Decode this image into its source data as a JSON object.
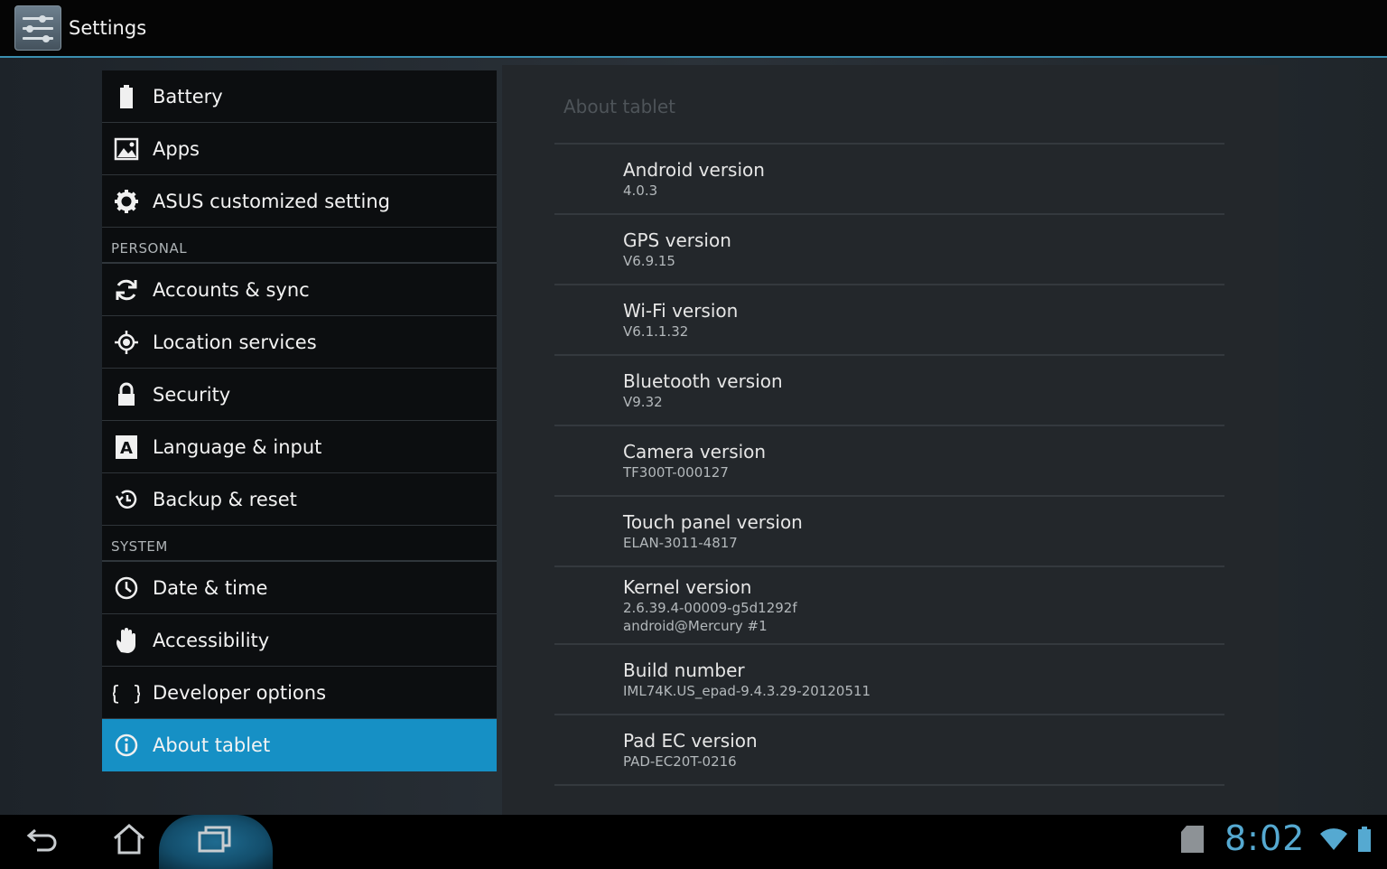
{
  "actionbar": {
    "title": "Settings",
    "icon": "settings-app-icon"
  },
  "sidebar": {
    "items": [
      {
        "type": "item",
        "label": "Battery",
        "icon": "battery-icon"
      },
      {
        "type": "item",
        "label": "Apps",
        "icon": "apps-icon"
      },
      {
        "type": "item",
        "label": "ASUS customized setting",
        "icon": "gear-icon"
      },
      {
        "type": "section",
        "label": "PERSONAL"
      },
      {
        "type": "item",
        "label": "Accounts & sync",
        "icon": "sync-icon"
      },
      {
        "type": "item",
        "label": "Location services",
        "icon": "location-icon"
      },
      {
        "type": "item",
        "label": "Security",
        "icon": "lock-icon"
      },
      {
        "type": "item",
        "label": "Language & input",
        "icon": "language-icon"
      },
      {
        "type": "item",
        "label": "Backup & reset",
        "icon": "backup-icon"
      },
      {
        "type": "section",
        "label": "SYSTEM"
      },
      {
        "type": "item",
        "label": "Date & time",
        "icon": "clock-icon"
      },
      {
        "type": "item",
        "label": "Accessibility",
        "icon": "hand-icon"
      },
      {
        "type": "item",
        "label": "Developer options",
        "icon": "braces-icon"
      },
      {
        "type": "item",
        "label": "About tablet",
        "icon": "info-icon",
        "selected": true
      }
    ]
  },
  "about": {
    "title": "About tablet",
    "entries": [
      {
        "title": "Android version",
        "values": [
          "4.0.3"
        ]
      },
      {
        "title": "GPS version",
        "values": [
          "V6.9.15"
        ]
      },
      {
        "title": "Wi-Fi version",
        "values": [
          "V6.1.1.32"
        ]
      },
      {
        "title": "Bluetooth version",
        "values": [
          "V9.32"
        ]
      },
      {
        "title": "Camera version",
        "values": [
          "TF300T-000127"
        ]
      },
      {
        "title": "Touch panel version",
        "values": [
          "ELAN-3011-4817"
        ]
      },
      {
        "title": "Kernel version",
        "values": [
          "2.6.39.4-00009-g5d1292f",
          "android@Mercury #1"
        ]
      },
      {
        "title": "Build number",
        "values": [
          "IML74K.US_epad-9.4.3.29-20120511"
        ]
      },
      {
        "title": "Pad EC version",
        "values": [
          "PAD-EC20T-0216"
        ]
      }
    ]
  },
  "navbar": {
    "back_icon": "back-icon",
    "home_icon": "home-icon",
    "recents_icon": "recent-apps-icon",
    "clock": "8:02",
    "status_icons": [
      "sd-card-icon",
      "wifi-icon",
      "battery-status-icon"
    ]
  },
  "colors": {
    "accent": "#1690c5",
    "divider": "#3b8fb0",
    "clock": "#55a9d1"
  }
}
